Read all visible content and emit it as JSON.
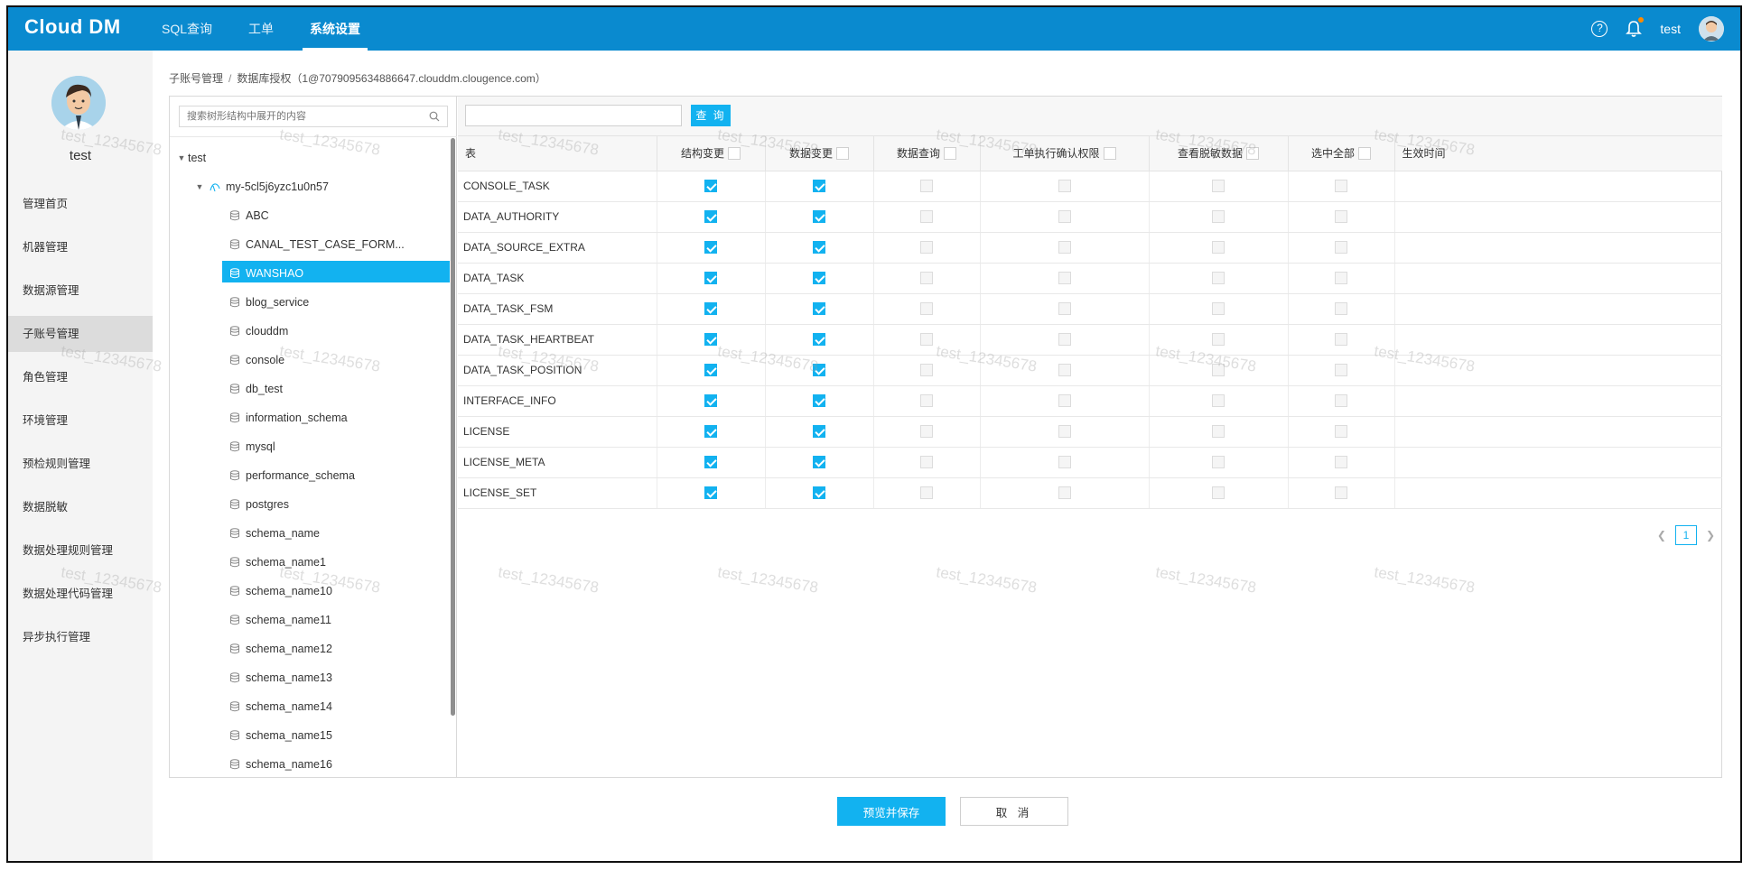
{
  "app": {
    "logo": "Cloud DM",
    "nav": [
      {
        "label": "SQL查询"
      },
      {
        "label": "工单"
      },
      {
        "label": "系统设置"
      }
    ],
    "user": "test"
  },
  "sidebar": {
    "username": "test",
    "items": [
      {
        "label": "管理首页"
      },
      {
        "label": "机器管理"
      },
      {
        "label": "数据源管理"
      },
      {
        "label": "子账号管理"
      },
      {
        "label": "角色管理"
      },
      {
        "label": "环境管理"
      },
      {
        "label": "预检规则管理"
      },
      {
        "label": "数据脱敏"
      },
      {
        "label": "数据处理规则管理"
      },
      {
        "label": "数据处理代码管理"
      },
      {
        "label": "异步执行管理"
      }
    ],
    "active_index": 3
  },
  "breadcrumb": {
    "parent": "子账号管理",
    "separator": "/",
    "current": "数据库授权（1@7079095634886647.clouddm.clougence.com）"
  },
  "tree": {
    "search_placeholder": "搜索树形结构中展开的内容",
    "root": "test",
    "instance": "my-5cl5j6yzc1u0n57",
    "databases": [
      "ABC",
      "CANAL_TEST_CASE_FORM...",
      "WANSHAO",
      "blog_service",
      "clouddm",
      "console",
      "db_test",
      "information_schema",
      "mysql",
      "performance_schema",
      "postgres",
      "schema_name",
      "schema_name1",
      "schema_name10",
      "schema_name11",
      "schema_name12",
      "schema_name13",
      "schema_name14",
      "schema_name15",
      "schema_name16"
    ],
    "selected": "WANSHAO"
  },
  "grid": {
    "query_label": "查 询",
    "columns": [
      "表",
      "结构变更",
      "数据变更",
      "数据查询",
      "工单执行确认权限",
      "查看脱敏数据",
      "选中全部",
      "生效时间"
    ],
    "rows": [
      {
        "table": "CONSOLE_TASK",
        "checks": [
          true,
          true,
          false,
          false,
          false,
          false
        ]
      },
      {
        "table": "DATA_AUTHORITY",
        "checks": [
          true,
          true,
          false,
          false,
          false,
          false
        ]
      },
      {
        "table": "DATA_SOURCE_EXTRA",
        "checks": [
          true,
          true,
          false,
          false,
          false,
          false
        ]
      },
      {
        "table": "DATA_TASK",
        "checks": [
          true,
          true,
          false,
          false,
          false,
          false
        ]
      },
      {
        "table": "DATA_TASK_FSM",
        "checks": [
          true,
          true,
          false,
          false,
          false,
          false
        ]
      },
      {
        "table": "DATA_TASK_HEARTBEAT",
        "checks": [
          true,
          true,
          false,
          false,
          false,
          false
        ]
      },
      {
        "table": "DATA_TASK_POSITION",
        "checks": [
          true,
          true,
          false,
          false,
          false,
          false
        ]
      },
      {
        "table": "INTERFACE_INFO",
        "checks": [
          true,
          true,
          false,
          false,
          false,
          false
        ]
      },
      {
        "table": "LICENSE",
        "checks": [
          true,
          true,
          false,
          false,
          false,
          false
        ]
      },
      {
        "table": "LICENSE_META",
        "checks": [
          true,
          true,
          false,
          false,
          false,
          false
        ]
      },
      {
        "table": "LICENSE_SET",
        "checks": [
          true,
          true,
          false,
          false,
          false,
          false
        ]
      }
    ],
    "page": "1"
  },
  "actions": {
    "save_label": "预览并保存",
    "cancel_label": "取 消"
  },
  "watermark": "test_12345678",
  "colors": {
    "topbar": "#0a8acf",
    "accent": "#12b2f0",
    "notification_dot": "#ff8a00"
  }
}
